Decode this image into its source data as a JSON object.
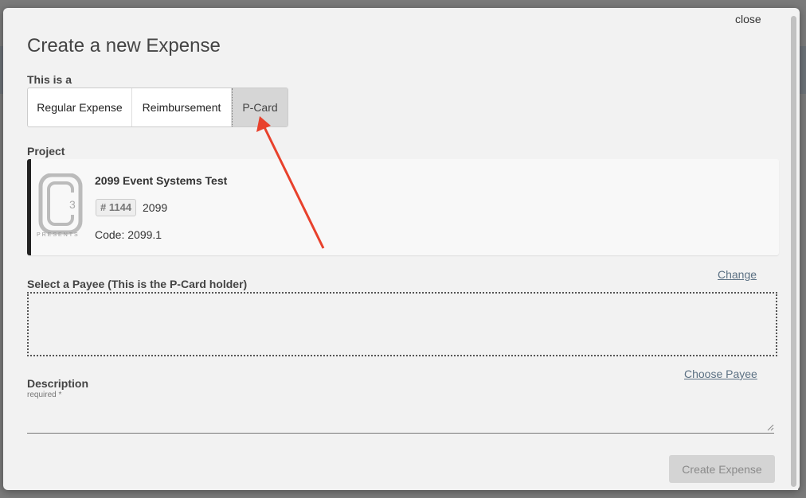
{
  "modal": {
    "close_label": "close",
    "title": "Create a new Expense"
  },
  "type_selector": {
    "label": "This is a",
    "options": [
      "Regular Expense",
      "Reimbursement",
      "P-Card"
    ],
    "selected": "P-Card"
  },
  "project": {
    "label": "Project",
    "name": "2099 Event Systems Test",
    "number_badge": "# 1144",
    "year": "2099",
    "code": "Code: 2099.1",
    "logo_text": "PRESENTS",
    "logo_mark": "3",
    "change_link": "Change"
  },
  "payee": {
    "label": "Select a Payee (This is the P-Card holder)",
    "choose_link": "Choose Payee"
  },
  "description": {
    "label": "Description",
    "required_note": "required *",
    "value": ""
  },
  "actions": {
    "create_label": "Create Expense"
  },
  "annotation": {
    "arrow_color": "#e8412c"
  }
}
